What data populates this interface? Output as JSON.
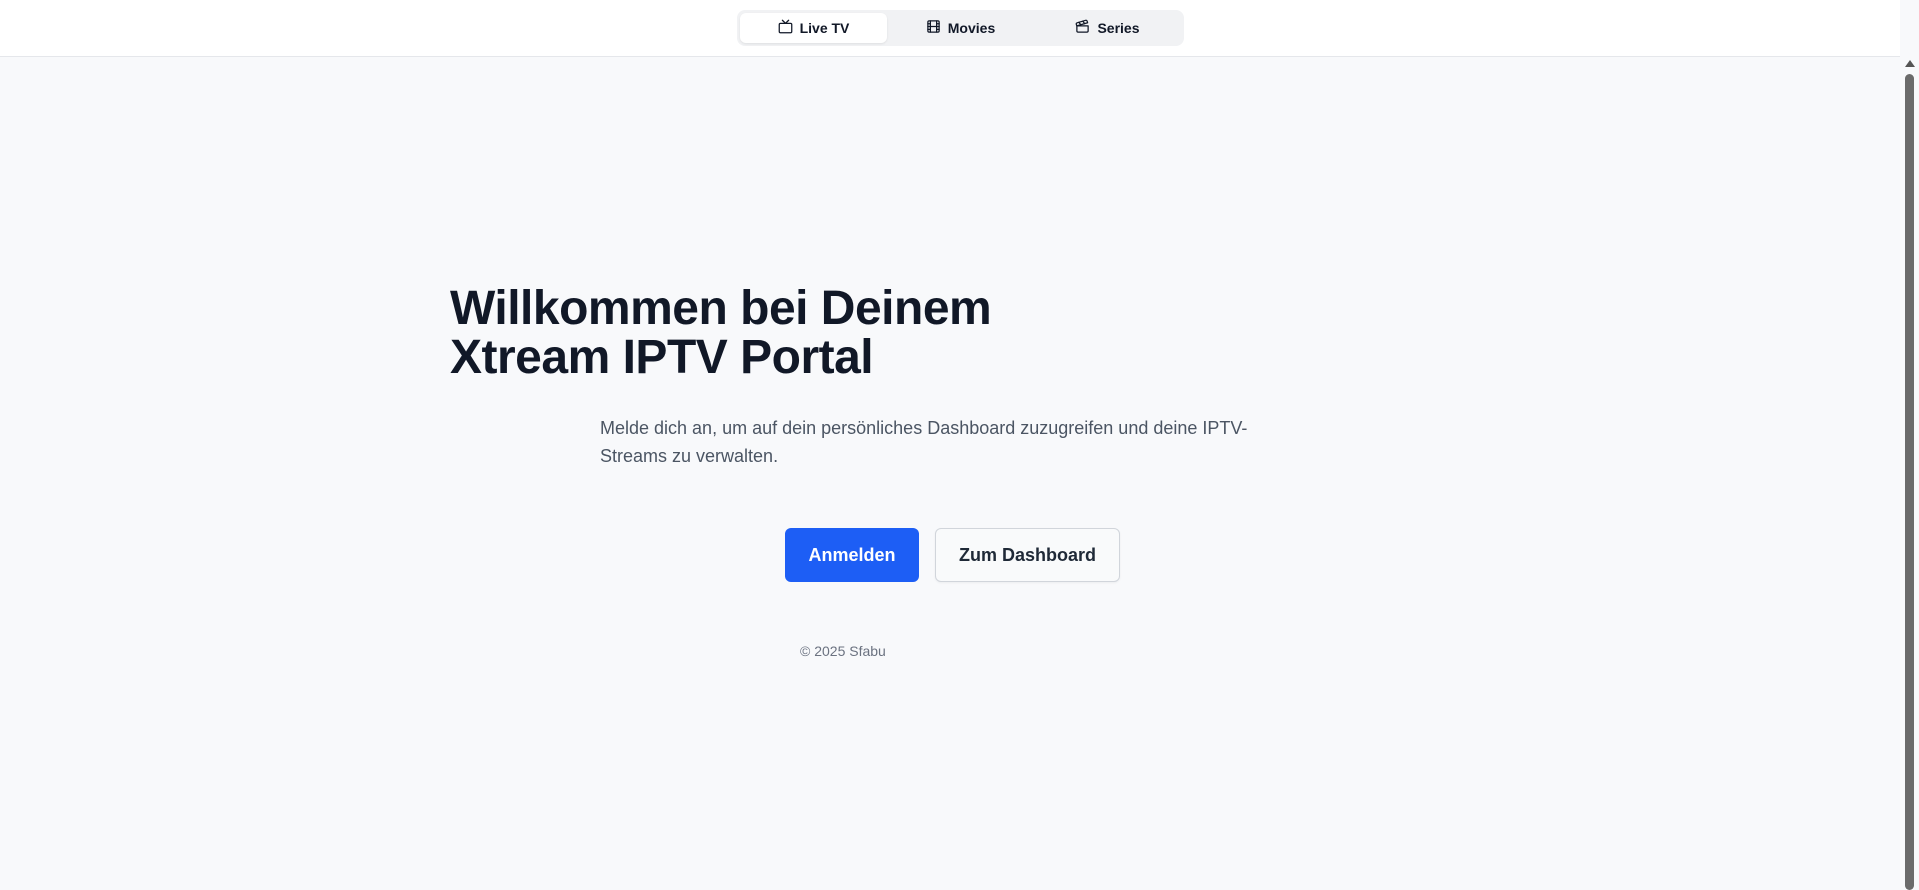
{
  "nav": {
    "tabs": [
      {
        "label": "Live TV",
        "icon": "tv-icon",
        "active": true
      },
      {
        "label": "Movies",
        "icon": "film-icon",
        "active": false
      },
      {
        "label": "Series",
        "icon": "clapperboard-icon",
        "active": false
      }
    ]
  },
  "hero": {
    "title_line1": "Willkommen bei Deinem",
    "title_line2": "Xtream IPTV Portal",
    "subtitle_line1": "Melde dich an, um auf dein persönliches Dashboard zuzugreifen und deine IPTV-",
    "subtitle_line2": "Streams zu verwalten.",
    "primary_button": "Anmelden",
    "secondary_button": "Zum Dashboard"
  },
  "footer": {
    "copyright": "© 2025 Sfabu"
  },
  "colors": {
    "accent": "#1d5ef5",
    "background": "#f8f9fb",
    "text": "#111827"
  }
}
